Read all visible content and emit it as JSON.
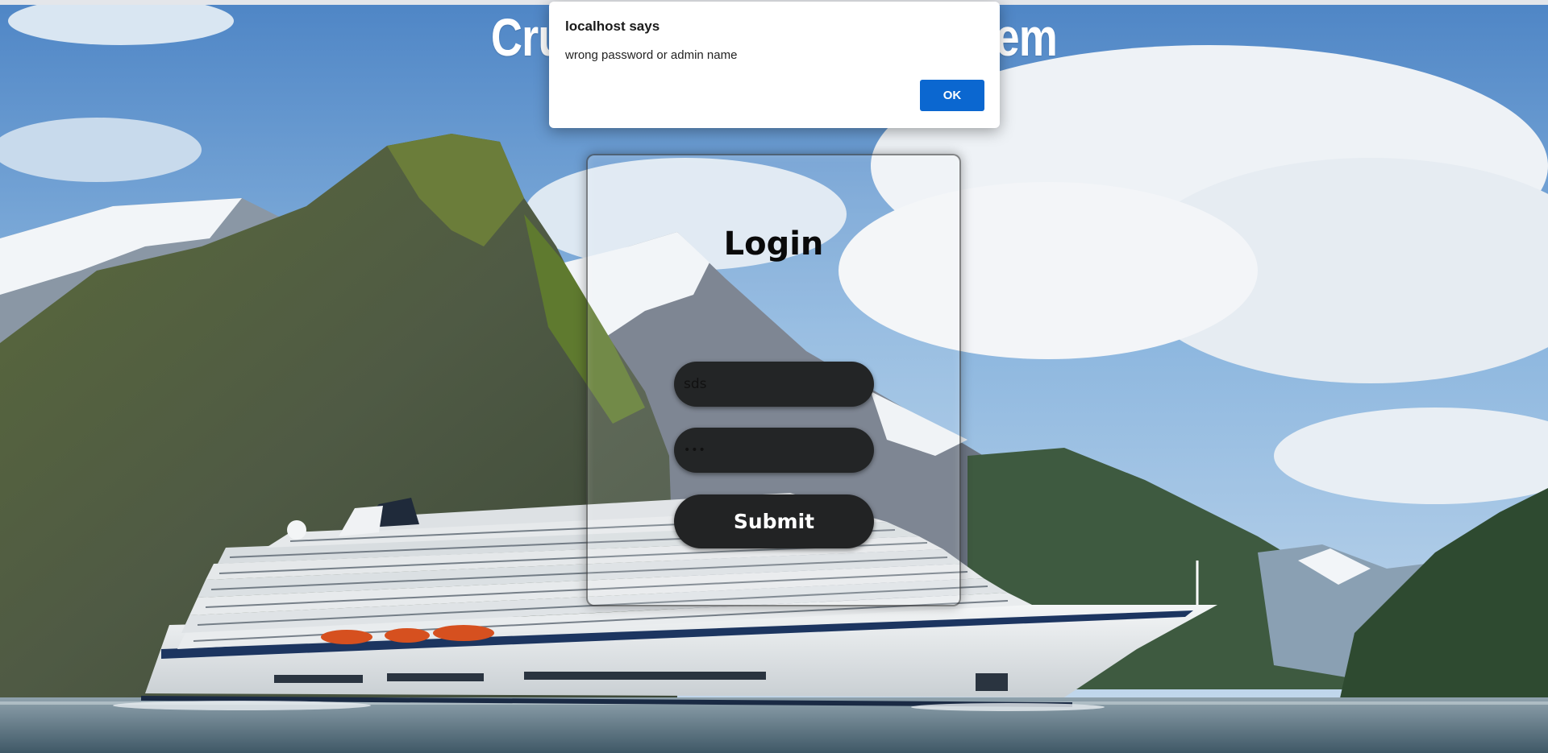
{
  "page": {
    "title": "Cruise Management System"
  },
  "login": {
    "heading": "Login",
    "username_value": "sds",
    "password_value": "•••",
    "submit_label": "Submit"
  },
  "alert": {
    "title": "localhost says",
    "message": "wrong password or admin name",
    "ok_label": "OK"
  },
  "colors": {
    "ok_button": "#0b67d0",
    "field_background": "#232526",
    "title_text": "#ffffff"
  }
}
